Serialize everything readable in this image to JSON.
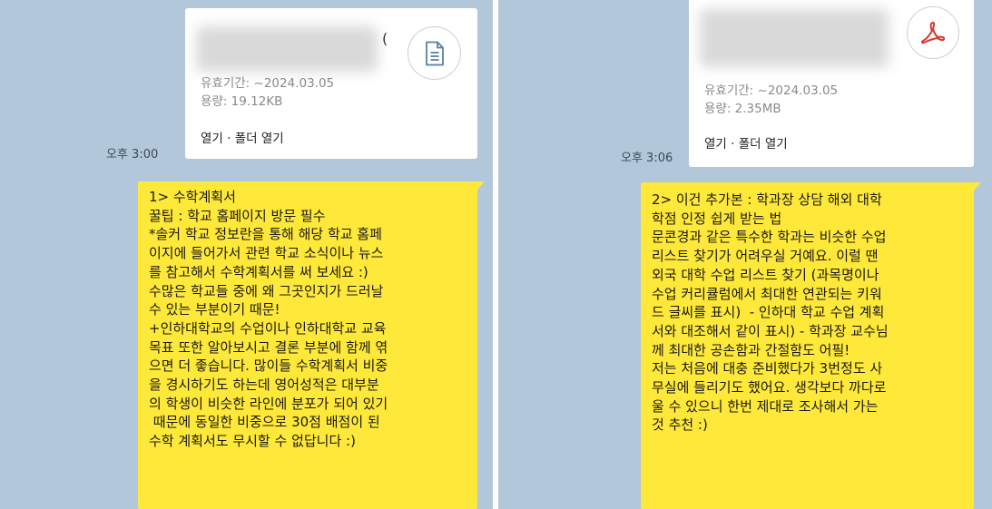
{
  "left_message": {
    "file": {
      "name_tail": "(",
      "expiry": "유효기간: ~2024.03.05",
      "size": "용량: 19.12KB",
      "actions": "열기 · 폴더 열기",
      "icon": "document-icon"
    },
    "time": "오후 3:00",
    "lines": [
      "1> 수학계획서",
      "꿀팁 : 학교 홈페이지 방문 필수",
      "*솔커 학교 정보란을 통해 해당 학교 홈페",
      "이지에 들어가서 관련 학교 소식이나 뉴스",
      "를 참고해서 수학계획서를 써 보세요 :)",
      "수많은 학교들 중에 왜 그곳인지가 드러날",
      "수 있는 부분이기 때문!",
      "+인하대학교의 수업이나 인하대학교 교육",
      "목표 또한 알아보시고 결론 부분에 함께 엮",
      "으면 더 좋습니다. 많이들 수학계획서 비중",
      "을 경시하기도 하는데 영어성적은 대부분",
      "의 학생이 비슷한 라인에 분포가 되어 있기",
      " 때문에 동일한 비중으로 30점 배점이 된",
      "수학 계획서도 무시할 수 없답니다 :)"
    ]
  },
  "right_message": {
    "file": {
      "expiry": "유효기간: ~2024.03.05",
      "size": "용량: 2.35MB",
      "actions": "열기 · 폴더 열기",
      "icon": "pdf-icon",
      "accent": "#d9342b"
    },
    "time": "오후 3:06",
    "lines": [
      "2> 이건 추가본 : 학과장 상담 해외 대학",
      "학점 인정 쉽게 받는 법",
      "문콘경과 같은 특수한 학과는 비슷한 수업",
      "리스트 찾기가 어려우실 거예요. 이럴 땐",
      "외국 대학 수업 리스트 찾기 (과목명이나",
      "수업 커리큘럼에서 최대한 연관되는 키워",
      "드 글씨를 표시)  - 인하대 학교 수업 계획",
      "서와 대조해서 같이 표시) - 학과장 교수님",
      "께 최대한 공손함과 간절함도 어필!",
      "저는 처음에 대충 준비했다가 3번정도 사",
      "무실에 들리기도 했어요. 생각보다 까다로",
      "울 수 있으니 한번 제대로 조사해서 가는",
      "것 추천 :)"
    ]
  }
}
